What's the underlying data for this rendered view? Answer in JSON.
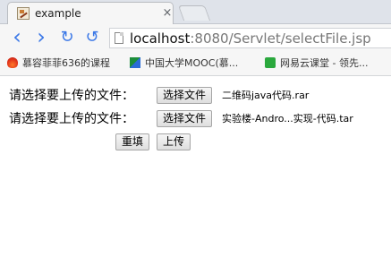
{
  "browser": {
    "tab": {
      "title": "example",
      "close_glyph": "×",
      "favicon_icon": "page-favicon-icon"
    },
    "nav": {
      "back_glyph": "‹",
      "forward_glyph": "›",
      "reload_glyph": "↻",
      "home_glyph": "↺"
    },
    "address": {
      "host": "localhost",
      "rest": ":8080/Servlet/selectFile.jsp"
    },
    "bookmarks": [
      {
        "label": "慕容菲菲636的课程",
        "icon": "flame-icon"
      },
      {
        "label": "中国大学MOOC(慕...",
        "icon": "mooc-icon"
      },
      {
        "label": "网易云课堂 - 领先...",
        "icon": "study-icon"
      }
    ]
  },
  "form": {
    "rows": [
      {
        "label": "请选择要上传的文件：",
        "button_label": "选择文件",
        "file_name": "二维码java代码.rar"
      },
      {
        "label": "请选择要上传的文件：",
        "button_label": "选择文件",
        "file_name": "实验楼-Andro...实现-代码.tar"
      }
    ],
    "reset_label": "重填",
    "submit_label": "上传"
  }
}
